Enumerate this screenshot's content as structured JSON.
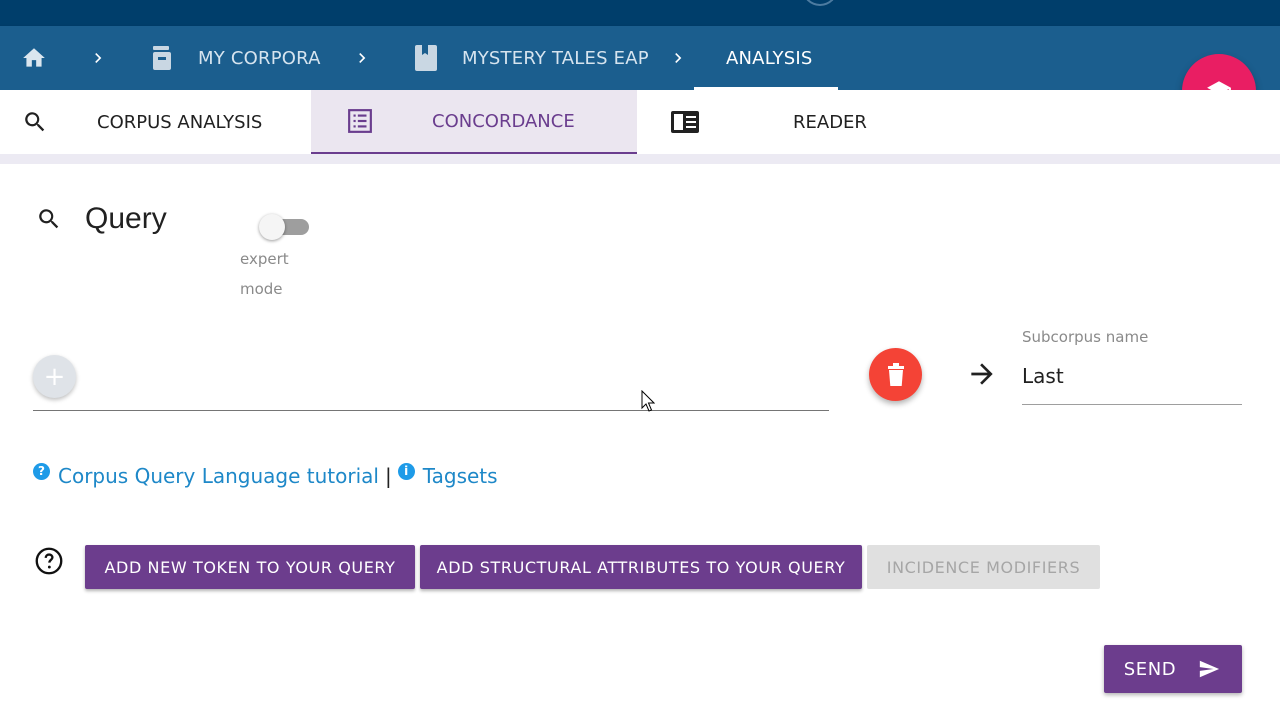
{
  "breadcrumb": {
    "items": [
      {
        "label": "MY CORPORA"
      },
      {
        "label": "MYSTERY TALES EAP"
      },
      {
        "label": "ANALYSIS"
      }
    ]
  },
  "tabs": [
    {
      "label": "CORPUS ANALYSIS",
      "icon": "search-icon"
    },
    {
      "label": "CONCORDANCE",
      "icon": "list-icon"
    },
    {
      "label": "READER",
      "icon": "reader-icon"
    }
  ],
  "query": {
    "title": "Query",
    "toggle_label": "expert mode",
    "toggle_on": false
  },
  "subcorpus": {
    "label": "Subcorpus name",
    "value": "Last"
  },
  "links": {
    "tutorial": "Corpus Query Language tutorial",
    "separator": "|",
    "tagsets": "Tagsets"
  },
  "buttons": {
    "add_token": "ADD NEW TOKEN TO YOUR QUERY",
    "add_structural": "ADD STRUCTURAL ATTRIBUTES TO YOUR QUERY",
    "incidence": "INCIDENCE MODIFIERS",
    "send": "SEND"
  },
  "colors": {
    "primary_blue": "#1b5e8e",
    "top_strip": "#003e6b",
    "accent_purple": "#6c3d8d",
    "fab_pink": "#e91e63",
    "delete_red": "#f44336",
    "link_blue": "#1e88c8"
  }
}
